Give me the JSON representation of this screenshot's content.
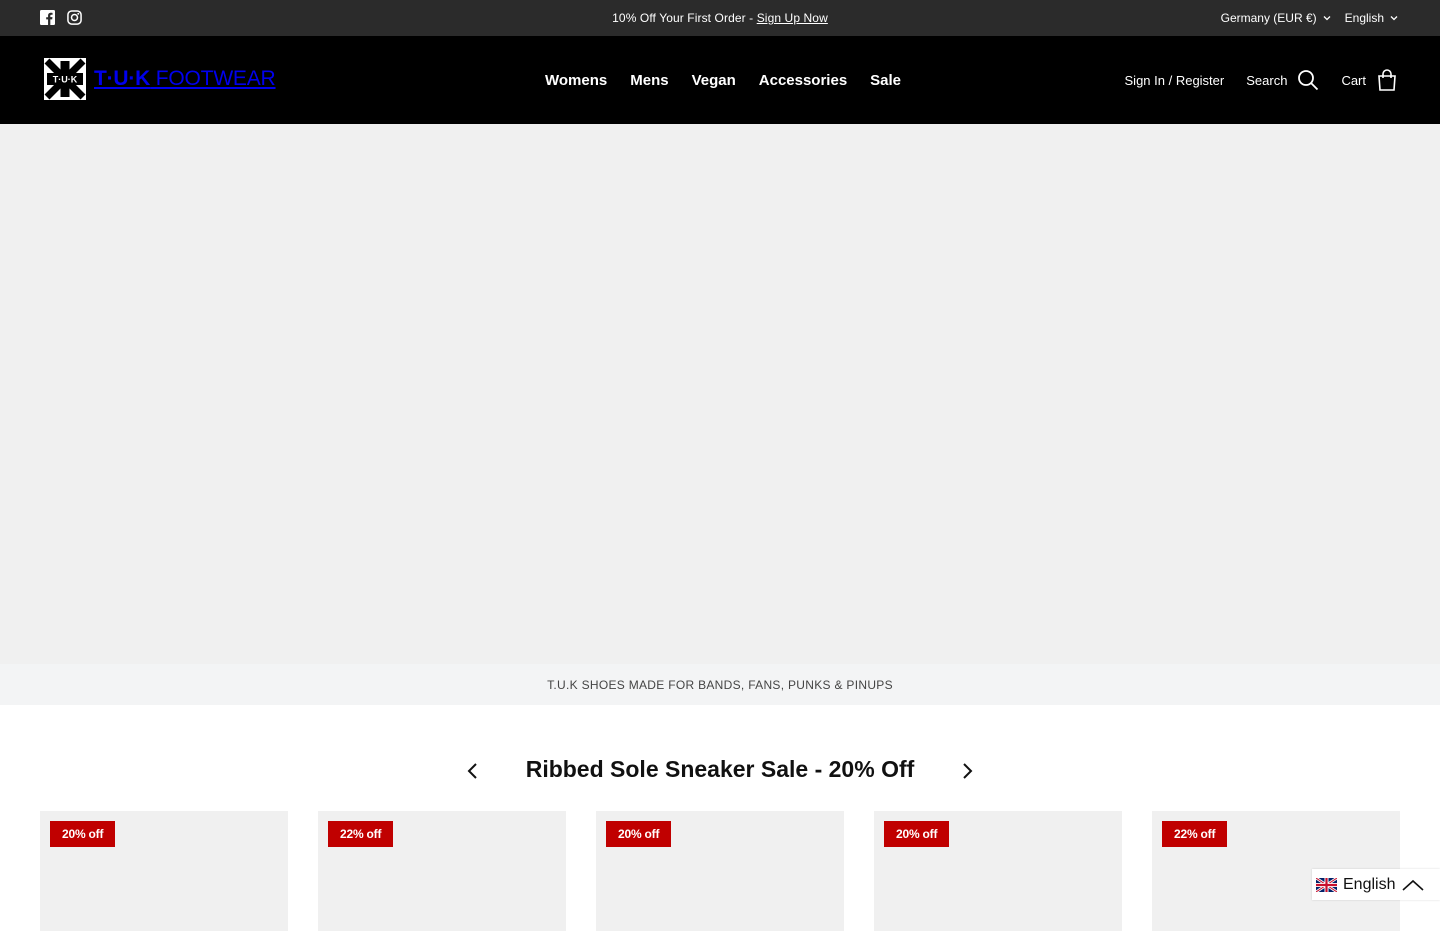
{
  "announcement": {
    "text": "10% Off Your First Order - ",
    "link": "Sign Up Now"
  },
  "locale": {
    "country": "Germany (EUR €)",
    "language": "English"
  },
  "brand": {
    "mark_text": "T·U·K",
    "name_bold": "T·U·K",
    "name_light": " FOOTWEAR"
  },
  "nav": {
    "items": [
      "Womens",
      "Mens",
      "Vegan",
      "Accessories",
      "Sale"
    ]
  },
  "account": {
    "sign_in": "Sign In / Register",
    "search": "Search",
    "cart": "Cart"
  },
  "tagline": "T.U.K SHOES MADE FOR BANDS, FANS, PUNKS & PINUPS",
  "collection": {
    "title": "Ribbed Sole Sneaker Sale - 20% Off"
  },
  "products": [
    {
      "badge": "20% off"
    },
    {
      "badge": "22% off"
    },
    {
      "badge": "20% off"
    },
    {
      "badge": "20% off"
    },
    {
      "badge": "22% off"
    }
  ],
  "language_widget": {
    "label": "English"
  },
  "colors": {
    "topbar": "#2b2b2b",
    "header": "#000000",
    "badge": "#c00000",
    "placeholder": "#f0f0f0"
  }
}
